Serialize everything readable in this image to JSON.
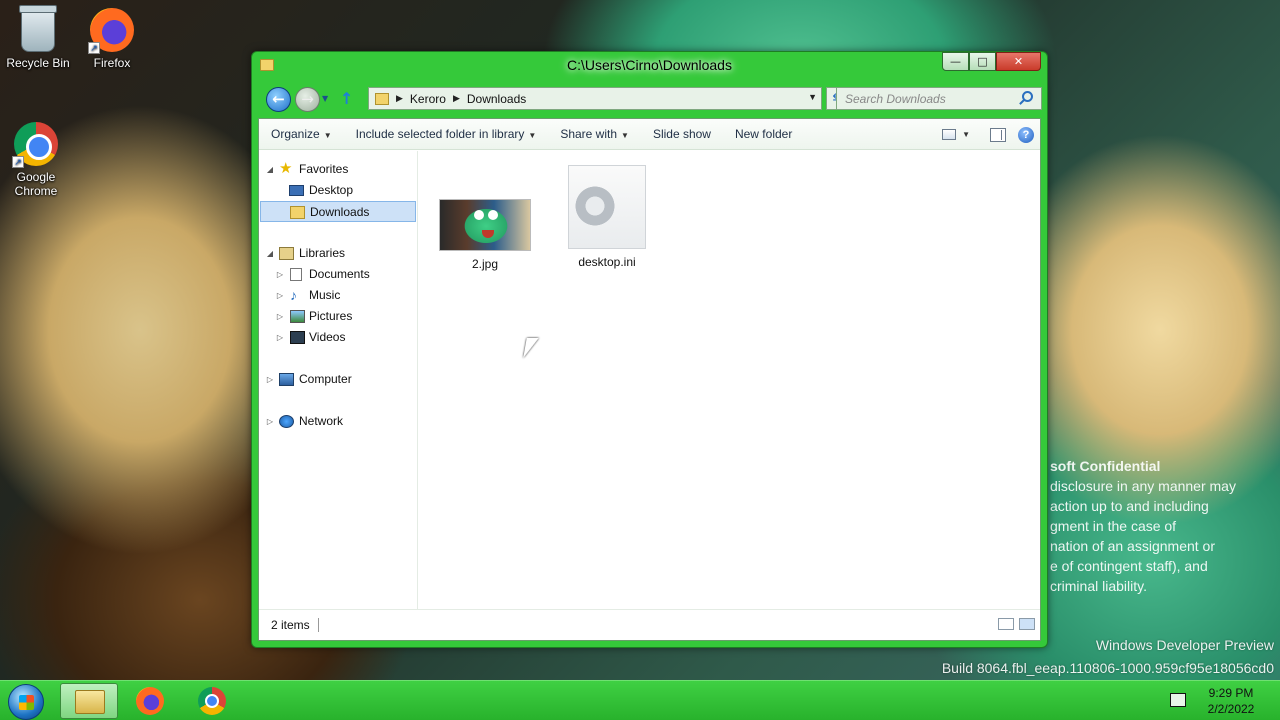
{
  "desktop": {
    "icons": [
      {
        "label": "Recycle Bin",
        "icon": "recycle-bin-icon"
      },
      {
        "label": "Firefox",
        "icon": "firefox-icon"
      },
      {
        "label": "Google Chrome",
        "icon": "chrome-icon"
      }
    ]
  },
  "window": {
    "title": "C:\\Users\\Cirno\\Downloads",
    "controls": {
      "minimize": "—",
      "maximize": "□",
      "close": "✕"
    }
  },
  "address": {
    "breadcrumb": [
      "Keroro",
      "Downloads"
    ]
  },
  "search": {
    "placeholder": "Search Downloads"
  },
  "toolbar": {
    "organize": "Organize",
    "include": "Include selected folder in library",
    "share": "Share with",
    "slideshow": "Slide show",
    "new_folder": "New folder"
  },
  "nav": {
    "favorites": "Favorites",
    "desktop": "Desktop",
    "downloads": "Downloads",
    "libraries": "Libraries",
    "documents": "Documents",
    "music": "Music",
    "pictures": "Pictures",
    "videos": "Videos",
    "computer": "Computer",
    "network": "Network"
  },
  "files": [
    {
      "name": "2.jpg",
      "type": "image"
    },
    {
      "name": "desktop.ini",
      "type": "config"
    }
  ],
  "status": {
    "count": "2 items"
  },
  "watermark": {
    "confidential_lines": [
      "soft Confidential",
      " disclosure in any manner may",
      " action up to and including",
      " gment in the case of",
      "nation of an assignment or",
      "e of contingent staff), and",
      "criminal liability."
    ],
    "line1": "Windows Developer Preview",
    "line2": "Build 8064.fbl_eeap.110806-1000.959cf95e18056cd0"
  },
  "taskbar": {
    "time": "9:29 PM",
    "date": "2/2/2022"
  },
  "colors": {
    "window_frame": "#35c93a",
    "taskbar": "#28b22c",
    "selection": "#cde1f7"
  }
}
